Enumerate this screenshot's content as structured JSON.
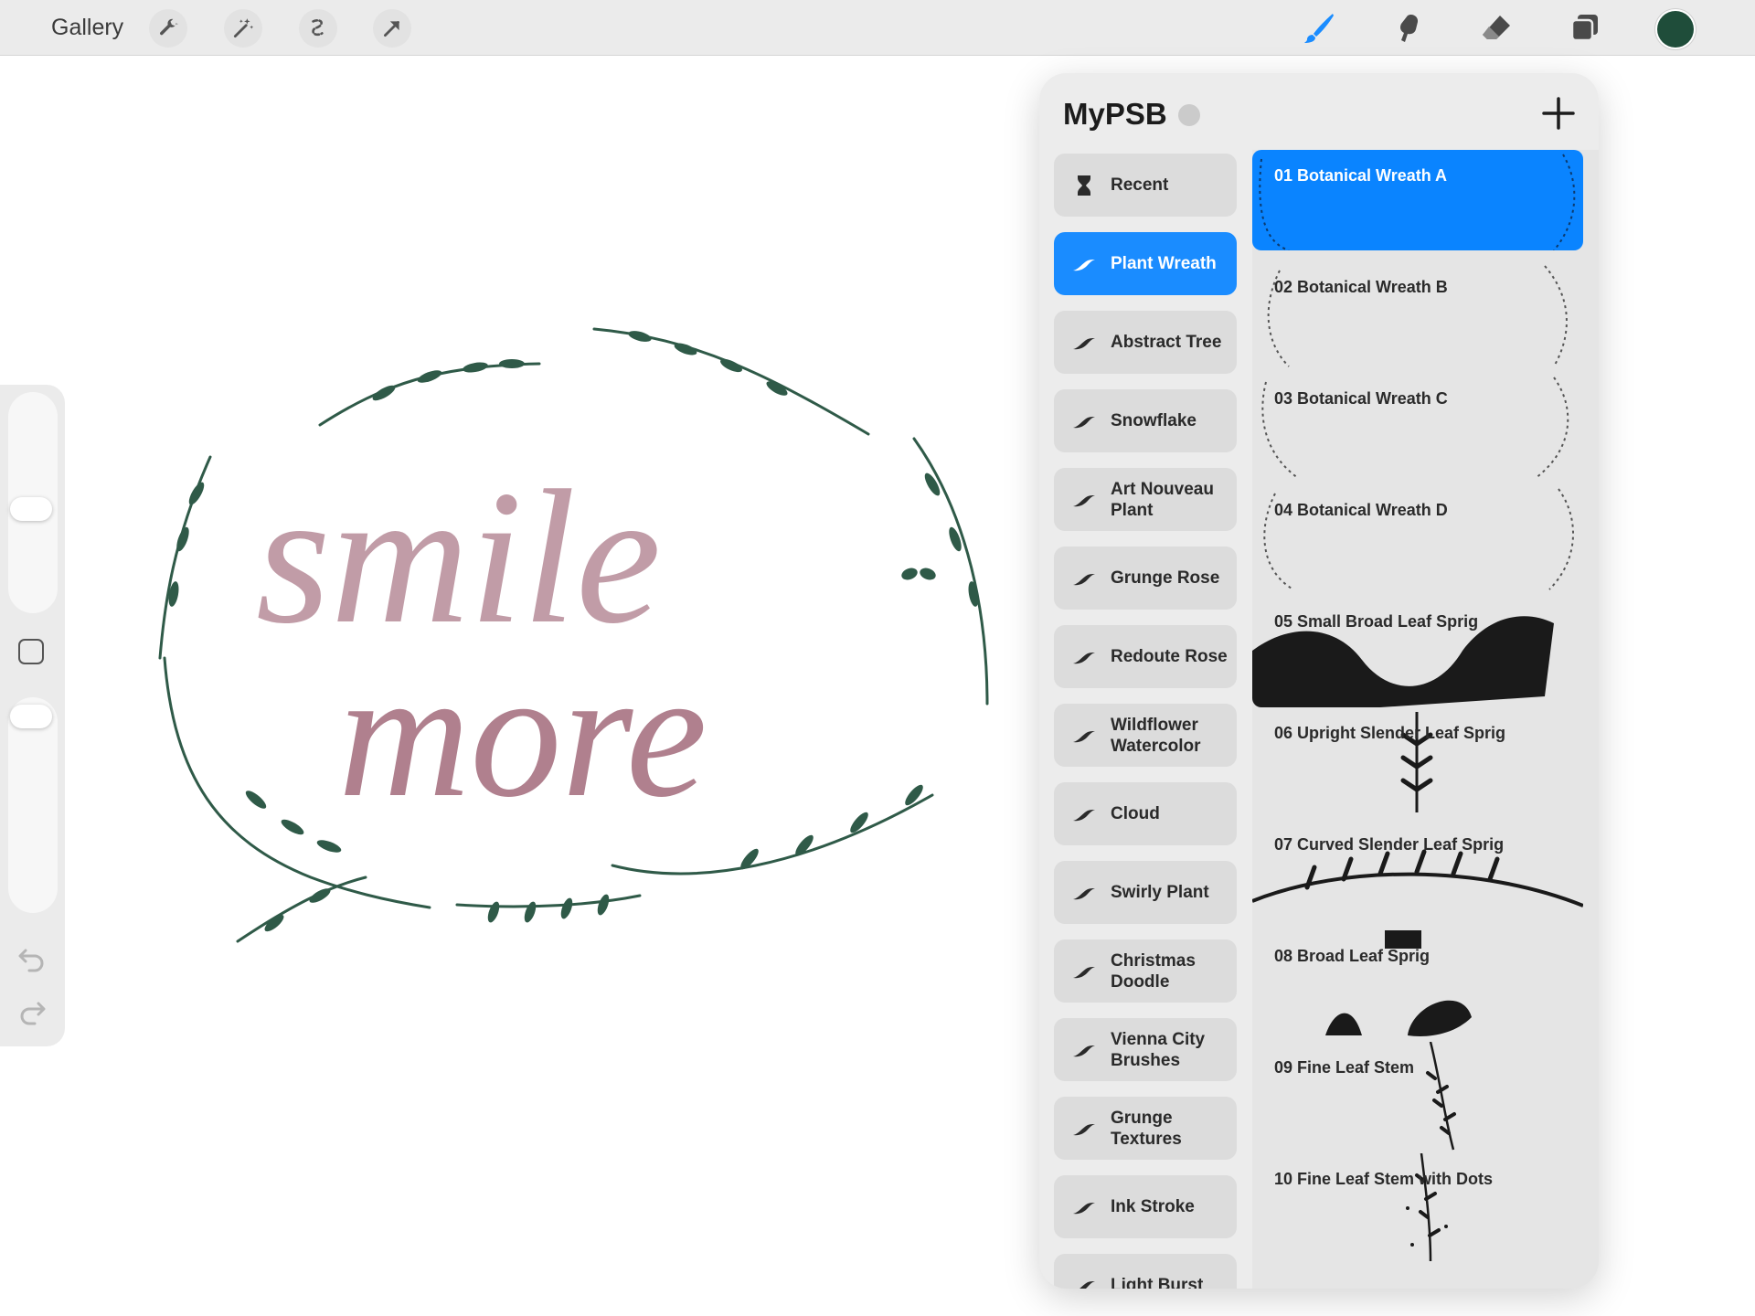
{
  "app": {
    "gallery_label": "Gallery",
    "accent_color": "#1a8cff",
    "active_color": "#1f4d3a"
  },
  "toolbar": {
    "left_tools": [
      "wrench-icon",
      "magic-wand-icon",
      "selection-icon",
      "transform-arrow-icon"
    ],
    "right_tools": [
      "brush-icon",
      "smudge-icon",
      "eraser-icon",
      "layers-icon"
    ]
  },
  "canvas": {
    "lettering_line1": "smile",
    "lettering_line2": "more",
    "lettering_color": "#8e4a5e",
    "foliage_color": "#2f5a48"
  },
  "library": {
    "title": "MyPSB",
    "add_label": "+",
    "sets": [
      {
        "label": "Recent",
        "icon": "hourglass-icon"
      },
      {
        "label": "Plant Wreath",
        "icon": "brush-stroke-icon",
        "selected": true
      },
      {
        "label": "Abstract Tree",
        "icon": "brush-stroke-icon"
      },
      {
        "label": "Snowflake",
        "icon": "brush-stroke-icon"
      },
      {
        "label": "Art Nouveau Plant",
        "icon": "brush-stroke-icon"
      },
      {
        "label": "Grunge Rose",
        "icon": "brush-stroke-icon"
      },
      {
        "label": "Redoute Rose",
        "icon": "brush-stroke-icon"
      },
      {
        "label": "Wildflower Watercolor",
        "icon": "brush-stroke-icon"
      },
      {
        "label": "Cloud",
        "icon": "brush-stroke-icon"
      },
      {
        "label": "Swirly Plant",
        "icon": "brush-stroke-icon"
      },
      {
        "label": "Christmas Doodle",
        "icon": "brush-stroke-icon"
      },
      {
        "label": "Vienna City Brushes",
        "icon": "brush-stroke-icon"
      },
      {
        "label": "Grunge Textures",
        "icon": "brush-stroke-icon"
      },
      {
        "label": "Ink Stroke",
        "icon": "brush-stroke-icon"
      },
      {
        "label": "Light Burst",
        "icon": "brush-stroke-icon"
      }
    ],
    "brushes": [
      {
        "name": "01 Botanical Wreath A",
        "selected": true
      },
      {
        "name": "02 Botanical Wreath B"
      },
      {
        "name": "03 Botanical Wreath C"
      },
      {
        "name": "04 Botanical Wreath D"
      },
      {
        "name": "05 Small Broad Leaf Sprig"
      },
      {
        "name": "06 Upright Slender Leaf Sprig"
      },
      {
        "name": "07 Curved Slender Leaf Sprig"
      },
      {
        "name": "08 Broad Leaf Sprig"
      },
      {
        "name": "09 Fine Leaf Stem"
      },
      {
        "name": "10 Fine Leaf Stem with Dots"
      }
    ]
  }
}
